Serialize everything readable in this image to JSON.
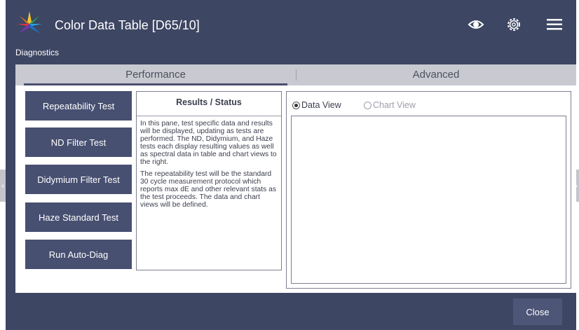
{
  "window": {
    "title": "Color Data Table [D65/10]",
    "subtitle": "Diagnostics",
    "icons": [
      "logo-icon",
      "eye-icon",
      "gear-icon",
      "hamburger-menu-icon"
    ]
  },
  "tabs": [
    {
      "label": "Performance",
      "selected": true
    },
    {
      "label": "Advanced",
      "selected": false
    }
  ],
  "tests": [
    {
      "label": "Repeatability Test"
    },
    {
      "label": "ND Filter Test"
    },
    {
      "label": "Didymium Filter Test"
    },
    {
      "label": "Haze Standard Test"
    },
    {
      "label": "Run Auto-Diag"
    }
  ],
  "status": {
    "heading": "Results / Status",
    "paragraphs": [
      "In this pane, test specific data and results will be displayed, updating as tests are performed. The ND, Didymium, and Haze tests each display resulting values as well as spectral data in table and chart views to the right.",
      "The repeatability test will be the standard 30 cycle measurement protocol which reports max dE and other relevant stats as the test proceeds. The data and chart views will be defined."
    ]
  },
  "view_options": [
    {
      "label": "Data View",
      "selected": true
    },
    {
      "label": "Chart View",
      "selected": false
    }
  ],
  "footer": {
    "close_label": "Close"
  },
  "colors": {
    "frame": "#3d4663",
    "button": "#475071",
    "tab_bar": "#c9cad1",
    "close_button": "#4e5677"
  }
}
